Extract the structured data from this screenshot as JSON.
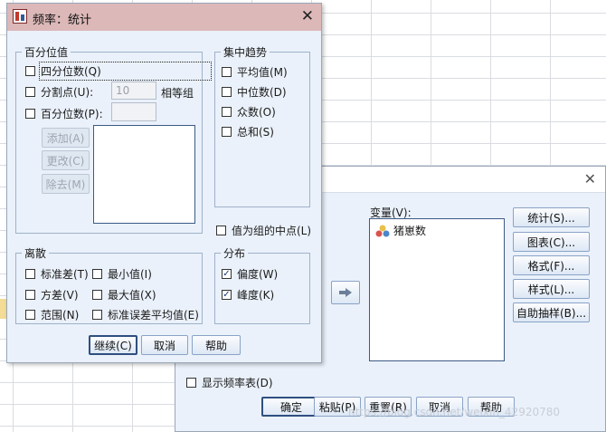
{
  "front_dialog": {
    "title": "频率：统计",
    "close_glyph": "✕",
    "percentiles": {
      "label": "百分位值",
      "quartiles": "四分位数(Q)",
      "cut_points": "分割点(U):",
      "cut_points_value": "10",
      "equal_groups": "相等组",
      "percentile": "百分位数(P):",
      "add": "添加(A)",
      "change": "更改(C)",
      "remove": "除去(M)"
    },
    "central_tendency": {
      "label": "集中趋势",
      "mean": "平均值(M)",
      "median": "中位数(D)",
      "mode": "众数(O)",
      "sum": "总和(S)"
    },
    "group_midpoints": "值为组的中点(L)",
    "dispersion": {
      "label": "离散",
      "std_dev": "标准差(T)",
      "minimum": "最小值(I)",
      "variance": "方差(V)",
      "maximum": "最大值(X)",
      "range": "范围(N)",
      "se_mean": "标准误差平均值(E)"
    },
    "distribution": {
      "label": "分布",
      "skewness": "偏度(W)",
      "kurtosis": "峰度(K)",
      "skewness_checked": true,
      "kurtosis_checked": true
    },
    "buttons": {
      "continue": "继续(C)",
      "cancel": "取消",
      "help": "帮助"
    }
  },
  "back_dialog": {
    "close_glyph": "✕",
    "variables_label": "变量(V):",
    "variables": [
      {
        "name": "猪崽数",
        "icon": "scale-variable-icon"
      }
    ],
    "side_buttons": [
      "统计(S)...",
      "图表(C)...",
      "格式(F)...",
      "样式(L)...",
      "自助抽样(B)..."
    ],
    "display_freq_tables": "显示频率表(D)",
    "bottom_buttons": {
      "ok": "确定",
      "paste": "粘贴(P)",
      "reset": "重置(R)",
      "cancel": "取消",
      "help": "帮助"
    }
  },
  "watermark": "https://blog.csdn.net/weixin_42920780"
}
